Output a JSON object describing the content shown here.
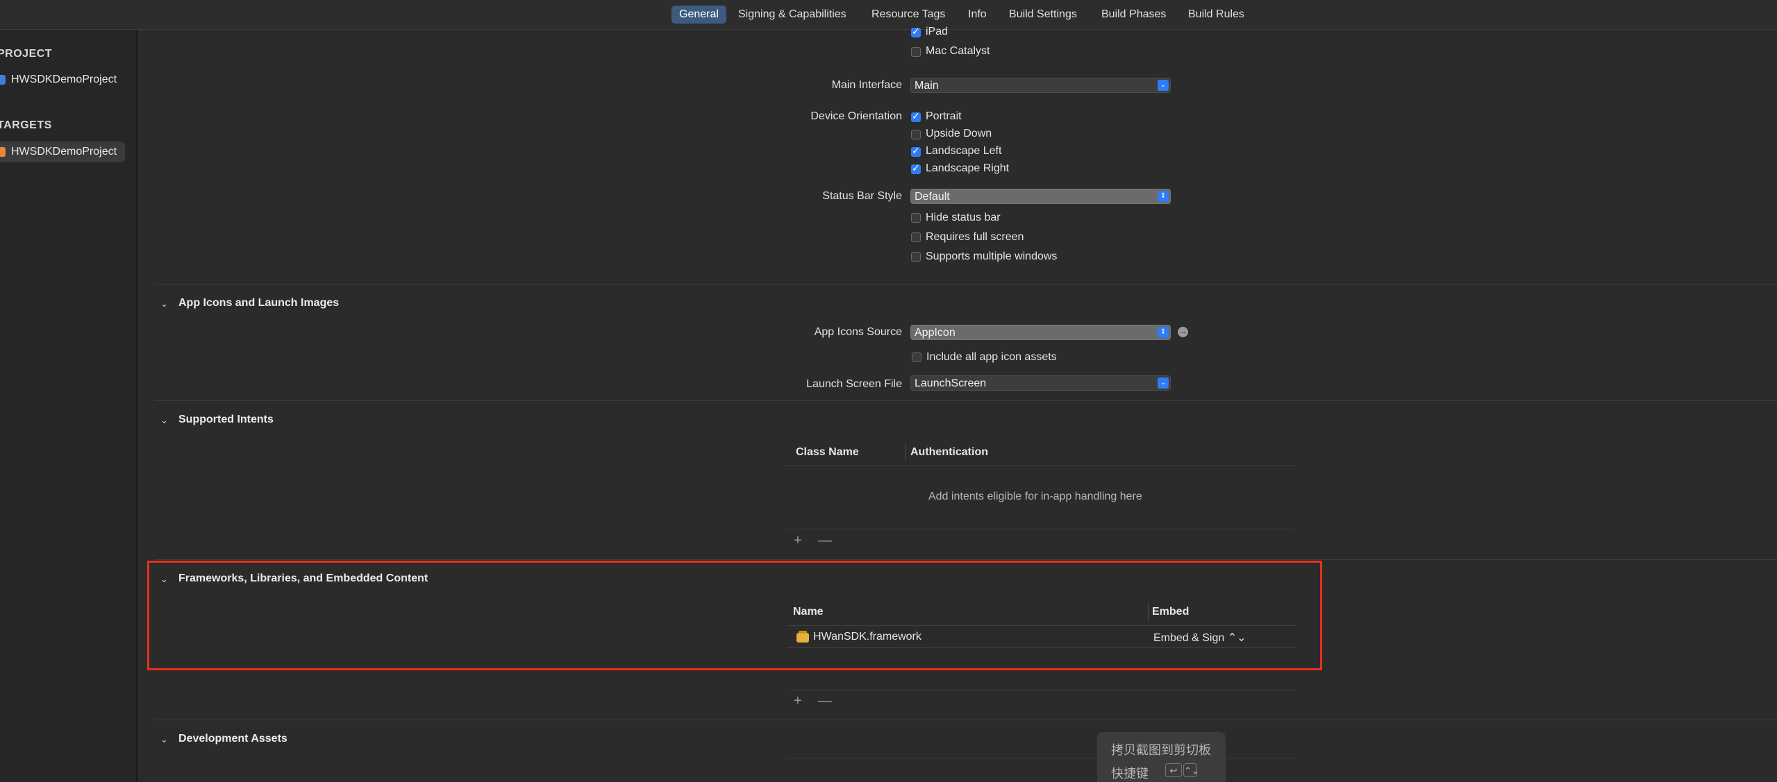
{
  "tabs": [
    {
      "label": "General",
      "active": true
    },
    {
      "label": "Signing & Capabilities",
      "active": false
    },
    {
      "label": "Resource Tags",
      "active": false
    },
    {
      "label": "Info",
      "active": false
    },
    {
      "label": "Build Settings",
      "active": false
    },
    {
      "label": "Build Phases",
      "active": false
    },
    {
      "label": "Build Rules",
      "active": false
    }
  ],
  "sidebar": {
    "project_header": "PROJECT",
    "project_item": "HWSDKDemoProject",
    "targets_header": "TARGETS",
    "target_item": "HWSDKDemoProject"
  },
  "deployment": {
    "ipad_label": "iPad",
    "ipad_checked": true,
    "mac_catalyst_label": "Mac Catalyst",
    "mac_catalyst_checked": false,
    "main_interface_label": "Main Interface",
    "main_interface_value": "Main",
    "device_orientation_label": "Device Orientation",
    "orientations": [
      {
        "label": "Portrait",
        "checked": true
      },
      {
        "label": "Upside Down",
        "checked": false
      },
      {
        "label": "Landscape Left",
        "checked": true
      },
      {
        "label": "Landscape Right",
        "checked": true
      }
    ],
    "status_bar_style_label": "Status Bar Style",
    "status_bar_style_value": "Default",
    "status_options": [
      {
        "label": "Hide status bar",
        "checked": false
      },
      {
        "label": "Requires full screen",
        "checked": false
      },
      {
        "label": "Supports multiple windows",
        "checked": false
      }
    ]
  },
  "app_icons": {
    "title": "App Icons and Launch Images",
    "source_label": "App Icons Source",
    "source_value": "AppIcon",
    "include_all_label": "Include all app icon assets",
    "include_all_checked": false,
    "launch_screen_label": "Launch Screen File",
    "launch_screen_value": "LaunchScreen"
  },
  "intents": {
    "title": "Supported Intents",
    "col_class": "Class Name",
    "col_auth": "Authentication",
    "empty_text": "Add intents eligible for in-app handling here",
    "add": "+",
    "remove": "—"
  },
  "frameworks": {
    "title": "Frameworks, Libraries, and Embedded Content",
    "col_name": "Name",
    "col_embed": "Embed",
    "rows": [
      {
        "name": "HWanSDK.framework",
        "embed": "Embed & Sign ⌃⌄"
      }
    ],
    "add": "+",
    "remove": "—"
  },
  "dev_assets": {
    "title": "Development Assets"
  },
  "clipboard_popup": {
    "line1": "拷贝截图到剪切板",
    "line2": "快捷键",
    "key1": "↩",
    "key2": "⌃⌄"
  },
  "colors": {
    "accent": "#2f7cf6",
    "highlight_border": "#e8301c",
    "background": "#2b2b2b"
  }
}
